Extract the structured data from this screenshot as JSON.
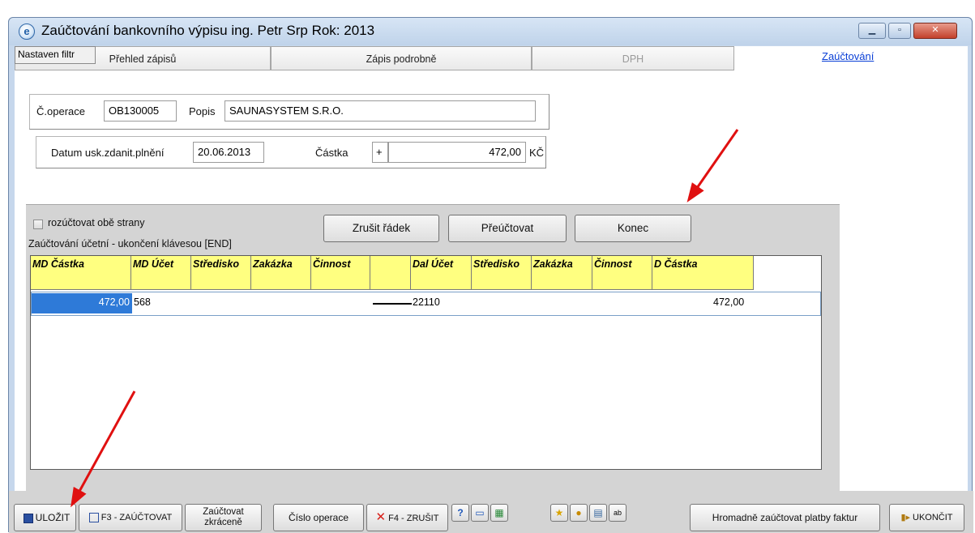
{
  "window": {
    "title": "Zaúčtování bankovního výpisu  ing. Petr Srp  Rok: 2013",
    "icon": "e-app-icon",
    "controls": [
      "minimize",
      "maximize",
      "close"
    ]
  },
  "tabs": {
    "filter": "Nastaven filtr",
    "items": [
      "Přehled zápisů",
      "Zápis podrobně",
      "DPH"
    ],
    "link": "Zaúčtování"
  },
  "operation": {
    "cislo_label": "Č.operace",
    "cislo_value": "OB130005",
    "popis_label": "Popis",
    "popis_value": "SAUNASYSTEM S.R.O.",
    "datum_label": "Datum usk.zdanit.plnění",
    "datum_value": "20.06.2013",
    "castka_label": "Částka",
    "castka_sign": "+",
    "castka_value": "472,00",
    "currency": "KČ"
  },
  "posting": {
    "checkbox_label": "rozúčtovat obě strany",
    "hint": "Zaúčtování účetní - ukončení klávesou [END]",
    "buttons": {
      "zrusit": "Zrušit řádek",
      "preuctovat": "Přeúčtovat",
      "konec": "Konec"
    },
    "columns": [
      "MD Částka",
      "MD Účet",
      "Středisko",
      "Zakázka",
      "Činnost",
      "",
      "Dal Účet",
      "Středisko",
      "Zakázka",
      "Činnost",
      "D Částka"
    ],
    "rows": [
      {
        "md_castka": "472,00",
        "md_ucet": "568",
        "dal_ucet": "22110",
        "d_castka": "472,00"
      }
    ]
  },
  "toolbar": {
    "ulozit": "ULOŽIT",
    "zauctovat": "F3 - ZAÚČTOVAT",
    "zkracene_1": "Zaúčtovat",
    "zkracene_2": "zkráceně",
    "cislo": "Číslo operace",
    "zrusit": "F4 - ZRUŠIT",
    "hromadne": "Hromadně zaúčtovat platby faktur",
    "ukoncit": "UKONČIT"
  },
  "colors": {
    "header_yellow": "#ffff80",
    "selection_blue": "#2e7ad8",
    "link_blue": "#0a3fd6",
    "arrow_red": "#e01010"
  }
}
